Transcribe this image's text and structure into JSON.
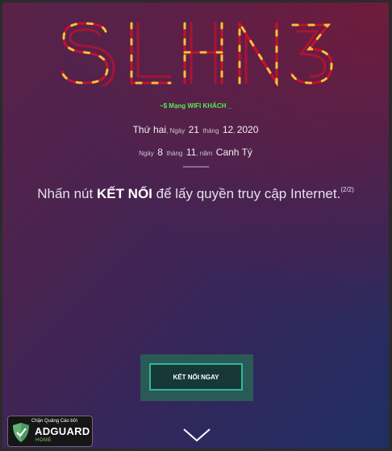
{
  "brand": {
    "logo_text": "SLHN3",
    "colors": {
      "logo_red": "#c8102e",
      "logo_yellow": "#f2c438",
      "accent_green": "#4ff04a",
      "button_border": "#2fb89a"
    }
  },
  "header": {
    "wifi_title": "~$ Mạng WIFI KHÁCH _"
  },
  "solar_date": {
    "weekday": "Thứ hai",
    "day_label": "Ngày",
    "day": "21",
    "month_label": "tháng",
    "month": "12",
    "year": "2020"
  },
  "lunar_date": {
    "day_label": "Ngày",
    "day": "8",
    "month_label": "tháng",
    "month": "11",
    "year_label": "năm",
    "year": "Canh Tý"
  },
  "divider": "--------------",
  "instruction": {
    "before": "Nhấn nút ",
    "bold": "KẾT NỐI",
    "after": " để lấy quyền truy cập Internet.",
    "step": "(2/2)"
  },
  "connect_button": {
    "label": "KẾT NỐI NGAY"
  },
  "scroll": {
    "icon": "chevron-down-icon"
  },
  "adblock_badge": {
    "tagline": "Chặn Quảng Cáo bởi",
    "brand": "ADGUARD",
    "product": "HOME",
    "icon": "shield-check-icon"
  }
}
